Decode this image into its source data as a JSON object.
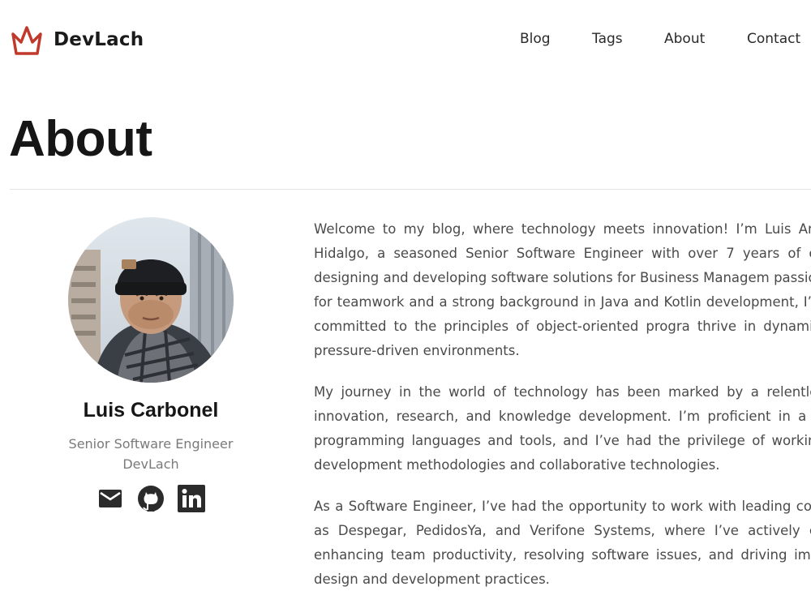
{
  "brand": {
    "name": "DevLach",
    "accent_color": "#c0392b"
  },
  "nav": {
    "items": [
      {
        "label": "Blog"
      },
      {
        "label": "Tags"
      },
      {
        "label": "About"
      },
      {
        "label": "Contact"
      }
    ]
  },
  "page": {
    "title": "About"
  },
  "profile": {
    "name": "Luis Carbonel",
    "role": "Senior Software Engineer",
    "company": "DevLach",
    "socials": [
      {
        "icon": "mail-icon"
      },
      {
        "icon": "github-icon"
      },
      {
        "icon": "linkedin-icon"
      }
    ]
  },
  "content": {
    "paragraphs": [
      "Welcome to my blog, where technology meets innovation! I’m Luis Ang Hidalgo, a seasoned Senior Software Engineer with over 7 years of ex designing and developing software solutions for Business Managem passion for teamwork and a strong background in Java and Kotlin development, I’m committed to the principles of object-oriented progra thrive in dynamic, pressure-driven environments.",
      "My journey in the world of technology has been marked by a relentles innovation, research, and knowledge development. I’m proficient in a w programming languages and tools, and I’ve had the privilege of working development methodologies and collaborative technologies.",
      "As a Software Engineer, I’ve had the opportunity to work with leading com as Despegar, PedidosYa, and Verifone Systems, where I’ve actively co enhancing team productivity, resolving software issues, and driving impr design and development practices."
    ]
  }
}
